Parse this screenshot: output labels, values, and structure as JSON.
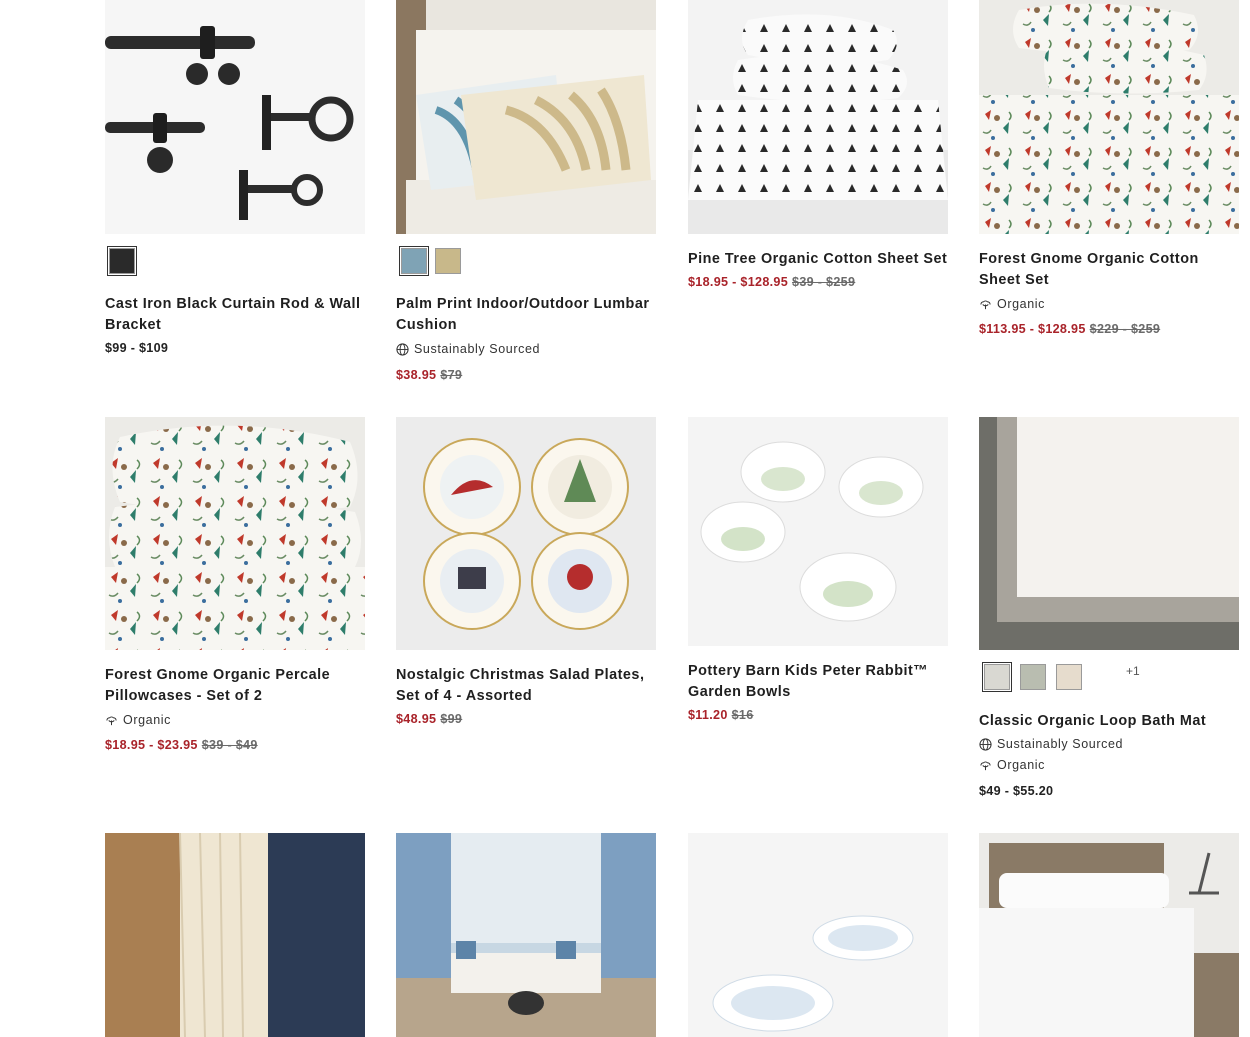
{
  "products": [
    {
      "title_line1": "Cast Iron Black Curtain Rod & Wall",
      "title_line2": "Bracket",
      "price": "$99 - $109",
      "swatch_colors": [
        "#2a2a2a"
      ]
    },
    {
      "title_line1": "Palm Print Indoor/Outdoor Lumbar",
      "title_line2": "Cushion",
      "tag": "Sustainably Sourced",
      "sale_price": "$38.95",
      "original_price": "$79",
      "swatch_colors": [
        "#7fa3b5",
        "#c8b88a"
      ]
    },
    {
      "title_line1": "Pine Tree Organic Cotton Sheet Set",
      "sale_price": "$18.95 - $128.95",
      "original_price": "$39 - $259"
    },
    {
      "title_line1": "Forest Gnome Organic Cotton",
      "title_line2": "Sheet Set",
      "tag": "Organic",
      "sale_price": "$113.95 - $128.95",
      "original_price": "$229 - $259"
    },
    {
      "title_line1": "Forest Gnome Organic Percale",
      "title_line2": "Pillowcases - Set of 2",
      "tag": "Organic",
      "sale_price": "$18.95 - $23.95",
      "original_price": "$39 - $49"
    },
    {
      "title_line1": "Nostalgic Christmas Salad Plates,",
      "title_line2": "Set of 4 - Assorted",
      "sale_price": "$48.95",
      "original_price": "$99"
    },
    {
      "title_line1": "Pottery Barn Kids Peter Rabbit™",
      "title_line2": "Garden Bowls",
      "sale_price": "$11.20",
      "original_price": "$16"
    },
    {
      "title_line1": "Classic Organic Loop Bath Mat",
      "tag": "Sustainably Sourced",
      "tag2": "Organic",
      "price": "$49 - $55.20",
      "swatch_colors": [
        "#d9d8d2",
        "#b9bdb0",
        "#e6dccd"
      ],
      "more_swatches": "+1"
    }
  ],
  "colors": {
    "sale": "#a9232a",
    "regular": "#222222",
    "strike": "#6a6a6a"
  },
  "icons": {
    "sustainable": "globe-icon",
    "organic": "cotton-leaf-icon"
  }
}
